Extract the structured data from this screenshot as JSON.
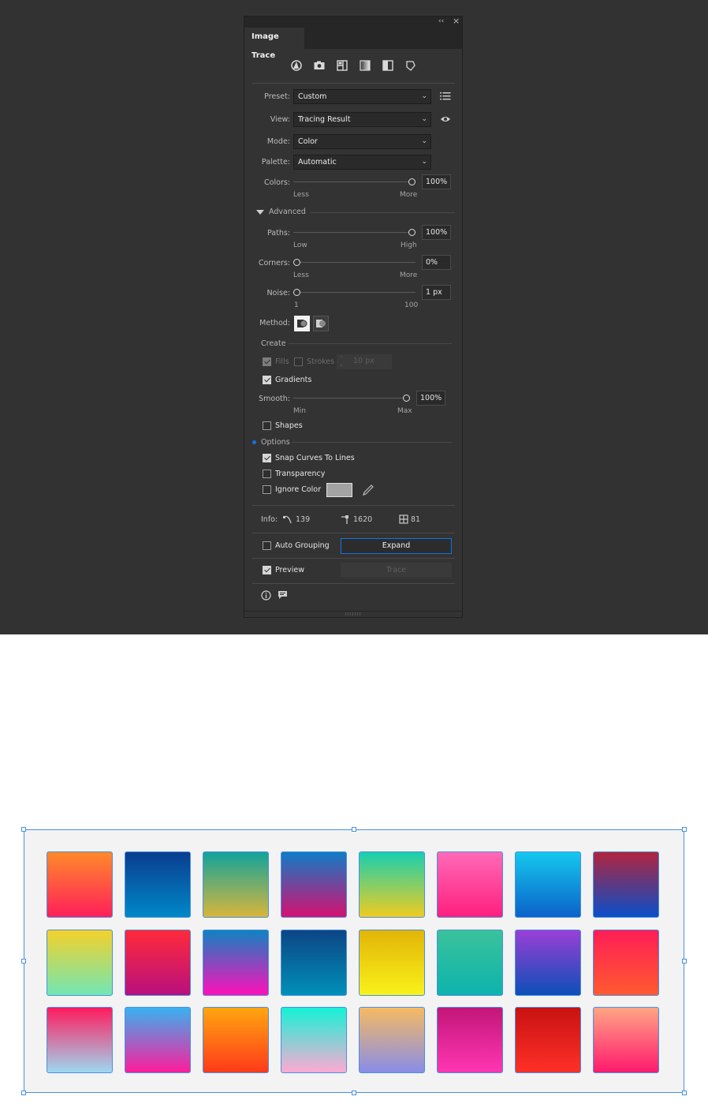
{
  "window": {
    "collapse_glyph": "‹‹",
    "close_glyph": "×",
    "tab_label": "Image Trace"
  },
  "preset_icons": [
    "auto-color-icon",
    "high-color-icon",
    "low-color-icon",
    "grayscale-icon",
    "black-white-icon",
    "outline-icon"
  ],
  "fields": {
    "preset": {
      "label": "Preset:",
      "value": "Custom"
    },
    "view": {
      "label": "View:",
      "value": "Tracing Result"
    },
    "mode": {
      "label": "Mode:",
      "value": "Color"
    },
    "palette": {
      "label": "Palette:",
      "value": "Automatic"
    }
  },
  "colors_slider": {
    "label": "Colors:",
    "value": "100%",
    "level": 1.0,
    "min_label": "Less",
    "max_label": "More"
  },
  "advanced": {
    "toggle_label": "Advanced",
    "paths": {
      "label": "Paths:",
      "value": "100%",
      "level": 1.0,
      "min_label": "Low",
      "max_label": "High"
    },
    "corners": {
      "label": "Corners:",
      "value": "0%",
      "level": 0.0,
      "min_label": "Less",
      "max_label": "More"
    },
    "noise": {
      "label": "Noise:",
      "value": "1 px",
      "level": 0.0,
      "min_label": "1",
      "max_label": "100"
    },
    "method_label": "Method:",
    "create": {
      "section_label": "Create",
      "fills": {
        "label": "Fills",
        "checked": true,
        "enabled": false
      },
      "strokes": {
        "label": "Strokes",
        "checked": false,
        "enabled": false,
        "value": "10 px"
      },
      "gradients": {
        "label": "Gradients",
        "checked": true
      },
      "smooth": {
        "label": "Smooth:",
        "value": "100%",
        "level": 1.0,
        "min_label": "Min",
        "max_label": "Max"
      },
      "shapes": {
        "label": "Shapes",
        "checked": false
      }
    },
    "options": {
      "section_label": "Options",
      "snap_curves": {
        "label": "Snap Curves To Lines",
        "checked": true
      },
      "transparency": {
        "label": "Transparency",
        "checked": false
      },
      "ignore_color": {
        "label": "Ignore Color",
        "checked": false,
        "swatch": "#a3a3a3"
      }
    }
  },
  "info": {
    "label": "Info:",
    "paths": "139",
    "anchors": "1620",
    "colors": "81"
  },
  "auto_grouping": {
    "label": "Auto Grouping",
    "checked": false
  },
  "expand_label": "Expand",
  "preview": {
    "label": "Preview",
    "checked": true
  },
  "trace_label": "Trace",
  "tiles": [
    [
      "#ff8a2a",
      "#ff1f5a"
    ],
    [
      "#0a3d8f",
      "#0088c8"
    ],
    [
      "#12a39c",
      "#d8b63a"
    ],
    [
      "#0f7cc7",
      "#d6106f"
    ],
    [
      "#18cfb0",
      "#f0cc20"
    ],
    [
      "#ff6ab8",
      "#ff1f7e"
    ],
    [
      "#15c8ee",
      "#0b62c9"
    ],
    [
      "#b0253e",
      "#0a4ec9"
    ],
    [
      "#f4d12a",
      "#72e6b5"
    ],
    [
      "#ff2a3a",
      "#b8107e"
    ],
    [
      "#0f83c2",
      "#ff10b8"
    ],
    [
      "#0c4586",
      "#0090b8"
    ],
    [
      "#e2b407",
      "#f9f21b"
    ],
    [
      "#3ac29b",
      "#0db3ad"
    ],
    [
      "#9b3fd6",
      "#0c4fb8"
    ],
    [
      "#ff1e56",
      "#ff5a30"
    ],
    [
      "#ff1b5e",
      "#9ed8f1"
    ],
    [
      "#38b2f1",
      "#ff1c9c"
    ],
    [
      "#ffa60f",
      "#ff3a1a"
    ],
    [
      "#14f2d6",
      "#ffaad3"
    ],
    [
      "#f6ba62",
      "#888de8"
    ],
    [
      "#c21679",
      "#ff36b2"
    ],
    [
      "#c81212",
      "#ff3028"
    ],
    [
      "#ffa585",
      "#ff1a6e"
    ]
  ],
  "colors": {
    "accent": "#1473e6",
    "selection": "#4a90e2",
    "panel_bg": "#333333"
  }
}
